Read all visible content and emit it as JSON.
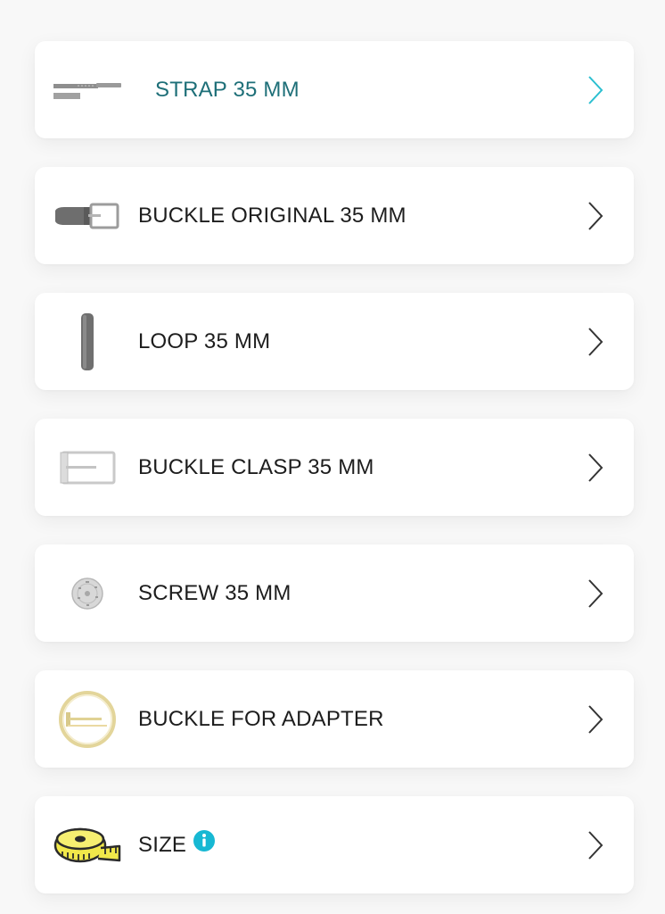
{
  "items": [
    {
      "label": "STRAP 35 MM",
      "thumb": "strap-thumbnail",
      "active": true
    },
    {
      "label": "BUCKLE ORIGINAL 35 MM",
      "thumb": "buckle-original-thumbnail"
    },
    {
      "label": "LOOP 35 MM",
      "thumb": "loop-thumbnail"
    },
    {
      "label": "BUCKLE CLASP 35 MM",
      "thumb": "buckle-clasp-thumbnail"
    },
    {
      "label": "SCREW 35 MM",
      "thumb": "screw-thumbnail"
    },
    {
      "label": "BUCKLE FOR ADAPTER",
      "thumb": "buckle-adapter-thumbnail"
    },
    {
      "label": "SIZE",
      "thumb": "tape-measure-icon",
      "has_info": true
    }
  ],
  "colors": {
    "active_text": "#1e6f78",
    "active_chevron": "#2bbfd0",
    "text": "#1d1d1d",
    "info": "#17b8d3",
    "tape": "#f1e84a"
  },
  "icons": {
    "chevron": "chevron-right-icon",
    "info": "info-icon"
  }
}
